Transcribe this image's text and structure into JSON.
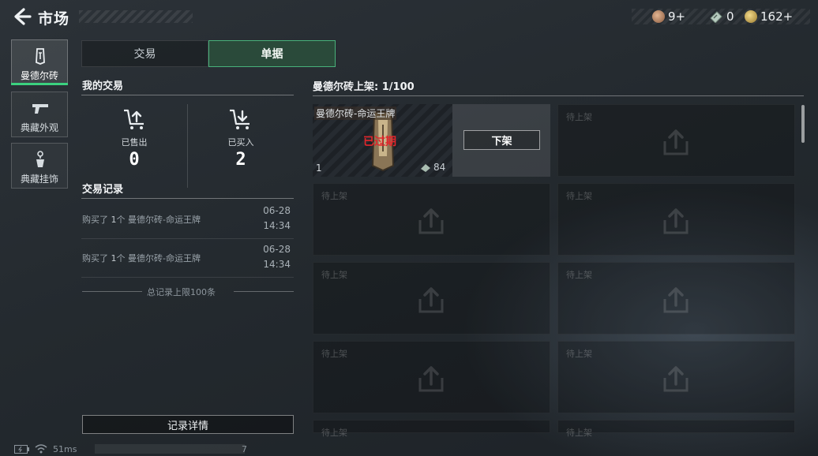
{
  "header": {
    "title": "市场",
    "currencies": [
      {
        "icon": "bronze-medal-icon",
        "value": "9+",
        "color": "#b98a6a"
      },
      {
        "icon": "ticket-icon",
        "value": "0",
        "color": "#9fb7a8"
      },
      {
        "icon": "gold-coin-icon",
        "value": "162+",
        "color": "#c9a855"
      }
    ]
  },
  "sidebar": {
    "items": [
      {
        "label": "曼德尔砖",
        "icon": "brick-icon",
        "active": true
      },
      {
        "label": "典藏外观",
        "icon": "pistol-icon",
        "active": false
      },
      {
        "label": "典藏挂饰",
        "icon": "charm-icon",
        "active": false
      }
    ]
  },
  "tabs": [
    {
      "label": "交易",
      "active": false
    },
    {
      "label": "单据",
      "active": true
    }
  ],
  "my_trades": {
    "title": "我的交易",
    "sold_label": "已售出",
    "sold_value": "0",
    "bought_label": "已买入",
    "bought_value": "2"
  },
  "records": {
    "title": "交易记录",
    "items": [
      {
        "prefix": "购买了 ",
        "count": "1",
        "unit": "个 ",
        "name": "曼德尔砖-命运王牌",
        "date": "06-28",
        "time": "14:34"
      },
      {
        "prefix": "购买了 ",
        "count": "1",
        "unit": "个 ",
        "name": "曼德尔砖-命运王牌",
        "date": "06-28",
        "time": "14:34"
      }
    ],
    "limit_note": "总记录上限100条",
    "detail_button": "记录详情"
  },
  "listings": {
    "title": "曼德尔砖上架: 1/100",
    "listed_item": {
      "name": "曼德尔砖-命运王牌",
      "status": "已过期",
      "quantity": "1",
      "price": "84",
      "action": "下架"
    },
    "empty_label": "待上架"
  },
  "status_bar": {
    "ping": "51ms",
    "extra": "7"
  }
}
